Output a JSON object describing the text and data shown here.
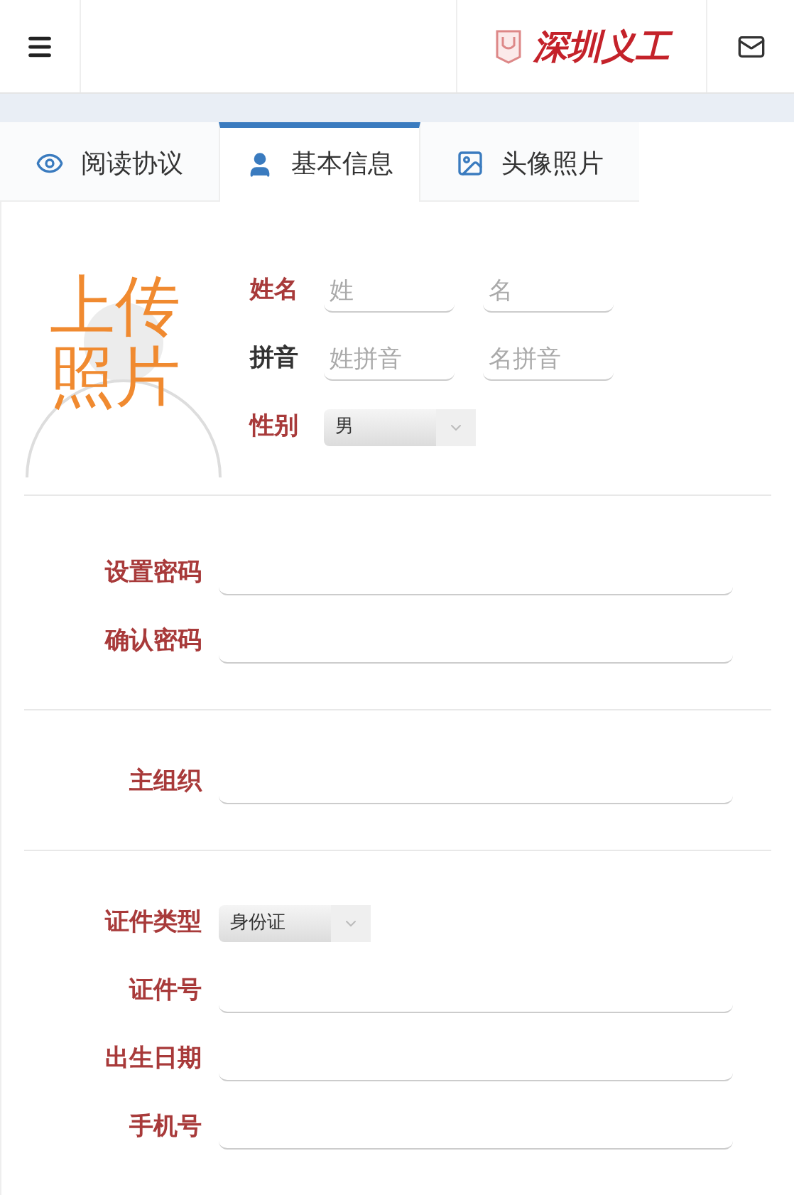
{
  "header": {
    "logo_text": "深圳义工"
  },
  "tabs": [
    {
      "label": "阅读协议",
      "selected": false
    },
    {
      "label": "基本信息",
      "selected": true
    },
    {
      "label": "头像照片",
      "selected": false
    }
  ],
  "photo": {
    "label": "上传照片"
  },
  "name_rows": [
    {
      "label": "姓名",
      "required": true,
      "kind": "pair",
      "placeholders": [
        "姓",
        "名"
      ]
    },
    {
      "label": "拼音",
      "required": false,
      "kind": "pair",
      "placeholders": [
        "姓拼音",
        "名拼音"
      ]
    },
    {
      "label": "性别",
      "required": true,
      "kind": "select",
      "value": "男"
    }
  ],
  "sections": [
    [
      {
        "label": "设置密码",
        "required": true,
        "kind": "input"
      },
      {
        "label": "确认密码",
        "required": true,
        "kind": "input"
      }
    ],
    [
      {
        "label": "主组织",
        "required": true,
        "kind": "input"
      }
    ],
    [
      {
        "label": "证件类型",
        "required": true,
        "kind": "select",
        "value": "身份证"
      },
      {
        "label": "证件号",
        "required": true,
        "kind": "input"
      },
      {
        "label": "出生日期",
        "required": true,
        "kind": "input"
      },
      {
        "label": "手机号",
        "required": true,
        "kind": "input"
      }
    ]
  ]
}
